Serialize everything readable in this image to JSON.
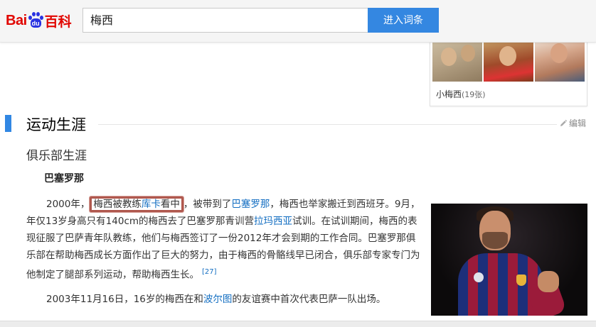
{
  "header": {
    "logo": {
      "part1": "Bai",
      "paw_text": "du",
      "part2": "百科"
    },
    "search": {
      "value": "梅西"
    },
    "button_label": "进入词条"
  },
  "album": {
    "caption": "小梅西",
    "count": "(19张)"
  },
  "section": {
    "title": "运动生涯",
    "edit_label": "编辑"
  },
  "subsection": {
    "title": "俱乐部生涯"
  },
  "heading3": "巴塞罗那",
  "para1": {
    "year": "2000年",
    "comma1": "，",
    "hl_before": "梅西被教练",
    "hl_link": "库卡",
    "hl_after": "看中",
    "comma2": "，",
    "text1": "被带到了",
    "link1": "巴塞罗那",
    "text2": "，梅西也举家搬迁到西班牙。9月，年仅13岁身高只有140cm的梅西去了巴塞罗那青训营",
    "link2": "拉玛西亚",
    "text3": "试训。在试训期间，梅西的表现征服了巴萨青年队教练，他们与梅西签订了一份2012年才会到期的工作合同。巴塞罗那俱乐部在帮助梅西成长方面作出了巨大的努力，由于梅西的骨骼线早已闭合，俱乐部专家专门为他制定了腿部系列运动，帮助梅西生长。",
    "footnote": "[27]"
  },
  "para2": {
    "text1": "2003年11月16日，16岁的梅西在和",
    "link": "波尔图",
    "text2": "的友谊赛中首次代表巴萨一队出场。"
  },
  "colors": {
    "accent": "#3187e3",
    "brand_red": "#e10601",
    "link": "#136ec2",
    "highlight_border": "#b0584e"
  },
  "icons": {
    "edit": "pencil-icon"
  }
}
